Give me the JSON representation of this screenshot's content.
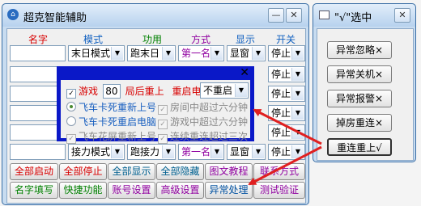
{
  "main_window": {
    "title": "超克智能辅助",
    "minimize_label": "—",
    "close_label": "✕",
    "icon": "home-icon"
  },
  "columns": {
    "name": "名字",
    "mode": "模式",
    "function": "功用",
    "style": "方式",
    "display": "显示",
    "switch": "开关"
  },
  "rows": [
    {
      "name": "",
      "mode": "末日模式",
      "function": "跑末日",
      "style": "第一名",
      "display": "显窗",
      "switch": "停止"
    },
    {
      "name": "",
      "mode": "",
      "function": "",
      "style": "",
      "display": "",
      "switch": "停止"
    },
    {
      "name": "",
      "mode": "",
      "function": "",
      "style": "",
      "display": "",
      "switch": "停止"
    },
    {
      "name": "",
      "mode": "",
      "function": "",
      "style": "",
      "display": "",
      "switch": "停止"
    },
    {
      "name": "",
      "mode": "",
      "function": "",
      "style": "",
      "display": "",
      "switch": "停止"
    },
    {
      "name": "",
      "mode": "接力模式",
      "function": "跑接力",
      "style": "第一名",
      "display": "显窗",
      "switch": "停止"
    }
  ],
  "bottom_buttons_row1": [
    "全部启动",
    "全部停止",
    "全部显示",
    "全部隐藏",
    "图文教程",
    "联系方式"
  ],
  "bottom_buttons_row2": [
    "名字填写",
    "快捷功能",
    "账号设置",
    "高级设置",
    "异常处理",
    "测试验证"
  ],
  "popup": {
    "close_label": "✕",
    "game_label": "游戏",
    "game_value": "80",
    "after_label": "局后重上",
    "restart_label": "重启电脑",
    "restart_value": "不重启",
    "options_left": [
      "飞车卡死重新上号",
      "飞车卡死重启电脑",
      "飞车花屏重新上号"
    ],
    "options_right": [
      "房间中超过六分钟",
      "游戏中超过六分钟",
      "连续重连超过三次"
    ],
    "check_mark": "✓"
  },
  "side_window": {
    "title": "\"√\"选中",
    "icon": "window-icon",
    "close_label": "✕",
    "buttons": [
      "异常忽略×",
      "异常关机×",
      "异常报警×",
      "掉房重连×",
      "重连重上√"
    ]
  },
  "colors": {
    "popup_border": "#0a18c8",
    "arrow": "#e02020",
    "row1_buttons": "#d80000",
    "row2_buttons": "#008000"
  }
}
